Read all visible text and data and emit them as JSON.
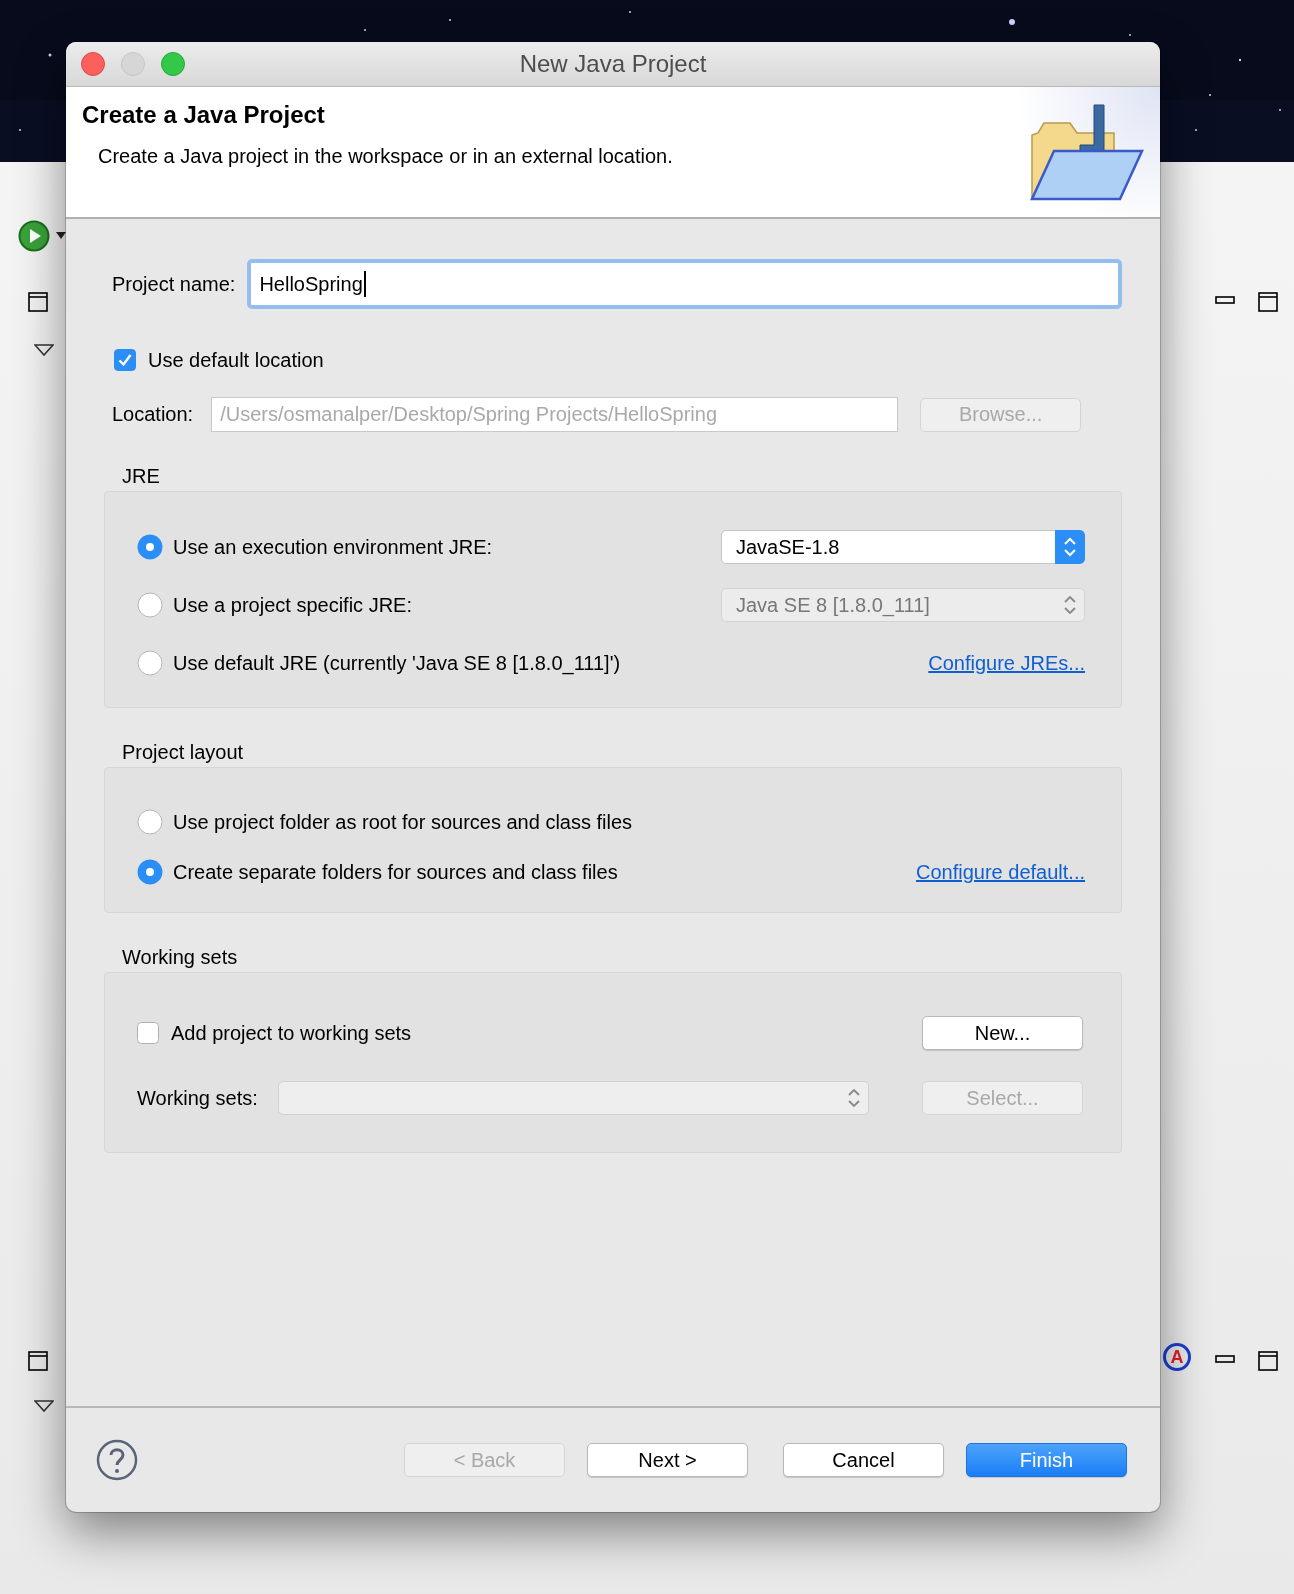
{
  "background": {
    "badge_letter": "A"
  },
  "window": {
    "title": "New Java Project"
  },
  "header": {
    "title": "Create a Java Project",
    "description": "Create a Java project in the workspace or in an external location."
  },
  "project_name": {
    "label": "Project name:",
    "value": "HelloSpring",
    "focused": true
  },
  "use_default_location": {
    "label": "Use default location",
    "checked": true
  },
  "location": {
    "label": "Location:",
    "value": "/Users/osmanalper/Desktop/Spring Projects/HelloSpring",
    "disabled": true,
    "button": {
      "label": "Browse...",
      "disabled": true
    }
  },
  "jre": {
    "title": "JRE",
    "options": [
      {
        "label": "Use an execution environment JRE:",
        "selected": true,
        "control": {
          "kind": "select",
          "value": "JavaSE-1.8",
          "disabled": false
        }
      },
      {
        "label": "Use a project specific JRE:",
        "selected": false,
        "control": {
          "kind": "select",
          "value": "Java SE 8 [1.8.0_111]",
          "disabled": true
        }
      },
      {
        "label": "Use default JRE (currently 'Java SE 8 [1.8.0_111]')",
        "selected": false,
        "control": {
          "kind": "link",
          "label": "Configure JREs..."
        }
      }
    ]
  },
  "project_layout": {
    "title": "Project layout",
    "options": [
      {
        "label": "Use project folder as root for sources and class files",
        "selected": false
      },
      {
        "label": "Create separate folders for sources and class files",
        "selected": true,
        "control": {
          "kind": "link",
          "label": "Configure default..."
        }
      }
    ]
  },
  "working_sets": {
    "title": "Working sets",
    "add": {
      "label": "Add project to working sets",
      "checked": false
    },
    "new_button": {
      "label": "New...",
      "disabled": false
    },
    "sets_label": "Working sets:",
    "sets_select": {
      "disabled": true
    },
    "select_button": {
      "label": "Select...",
      "disabled": true
    }
  },
  "buttons": [
    {
      "label": "< Back",
      "disabled": true,
      "default": false
    },
    {
      "label": "Next >",
      "disabled": false,
      "default": false
    },
    {
      "label": "Cancel",
      "disabled": false,
      "default": false
    },
    {
      "label": "Finish",
      "disabled": false,
      "default": true
    }
  ]
}
